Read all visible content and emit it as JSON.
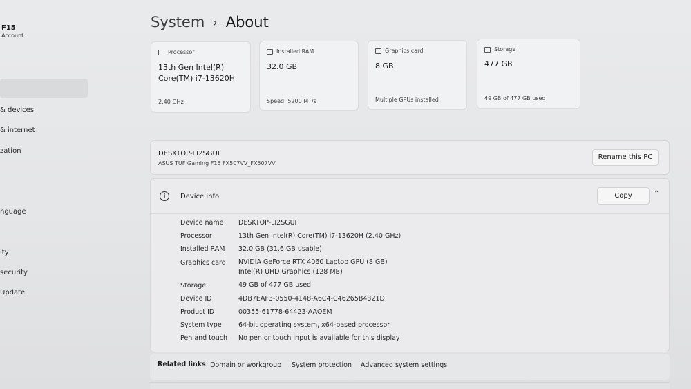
{
  "sidebar": {
    "user_name": "F15",
    "user_sub": "Account",
    "items": [
      {
        "label": "& devices"
      },
      {
        "label": "& internet"
      },
      {
        "label": "zation"
      },
      {
        "label": "nguage"
      },
      {
        "label": "ity"
      },
      {
        "label": "security"
      },
      {
        "label": "Update"
      }
    ]
  },
  "header": {
    "parent": "System",
    "separator": "›",
    "current": "About"
  },
  "cards": [
    {
      "label": "Processor",
      "icon": "cpu-icon",
      "value": "13th Gen Intel(R) Core(TM) i7-13620H",
      "sub": "2.40 GHz"
    },
    {
      "label": "Installed RAM",
      "icon": "ram-icon",
      "value": "32.0 GB",
      "sub": "Speed: 5200 MT/s"
    },
    {
      "label": "Graphics card",
      "icon": "gpu-icon",
      "value": "8 GB",
      "sub": "Multiple GPUs installed"
    },
    {
      "label": "Storage",
      "icon": "storage-icon",
      "value": "477 GB",
      "sub": "49 GB of 477 GB used"
    }
  ],
  "device": {
    "name": "DESKTOP-LI2SGUI",
    "model": "ASUS TUF Gaming F15 FX507VV_FX507VV",
    "rename_label": "Rename this PC"
  },
  "device_info": {
    "title": "Device info",
    "copy_label": "Copy",
    "specs": [
      {
        "label": "Device name",
        "value": "DESKTOP-LI2SGUI"
      },
      {
        "label": "Processor",
        "value": "13th Gen Intel(R) Core(TM) i7-13620H (2.40 GHz)"
      },
      {
        "label": "Installed RAM",
        "value": "32.0 GB (31.6 GB usable)"
      },
      {
        "label": "Graphics card",
        "value": "NVIDIA GeForce RTX 4060 Laptop GPU (8 GB)",
        "value2": "Intel(R) UHD Graphics (128 MB)"
      },
      {
        "label": "Storage",
        "value": "49 GB of 477 GB used"
      },
      {
        "label": "Device ID",
        "value": "4DB7EAF3-0550-4148-A6C4-C46265B4321D"
      },
      {
        "label": "Product ID",
        "value": "00355-61778-64423-AAOEM"
      },
      {
        "label": "System type",
        "value": "64-bit operating system, x64-based processor"
      },
      {
        "label": "Pen and touch",
        "value": "No pen or touch input is available for this display"
      }
    ]
  },
  "related": {
    "title": "Related links",
    "links": [
      "Domain or workgroup",
      "System protection",
      "Advanced system settings"
    ]
  }
}
